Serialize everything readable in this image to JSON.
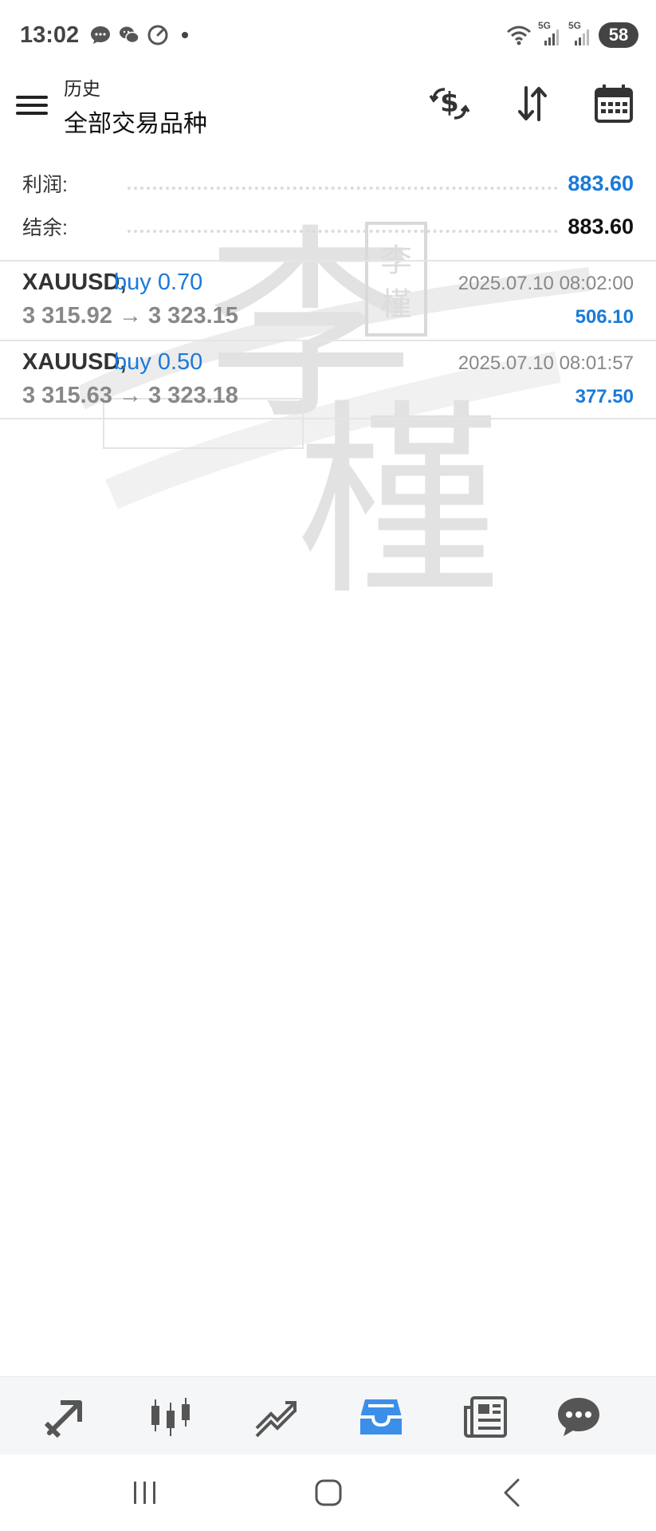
{
  "status_bar": {
    "time": "13:02",
    "signal_label_1": "5G",
    "signal_label_2": "5G",
    "battery": "58",
    "icons": [
      "message-icon",
      "wechat-icon",
      "speed-icon",
      "dot-icon",
      "wifi-icon",
      "signal-icon",
      "signal-icon",
      "battery-icon"
    ]
  },
  "app_bar": {
    "title_small": "历史",
    "title_main": "全部交易品种",
    "actions": [
      "dollar-swap-icon",
      "sort-icon",
      "calendar-icon"
    ]
  },
  "summary": {
    "profit_label": "利润:",
    "profit_value": "883.60",
    "balance_label": "结余:",
    "balance_value": "883.60",
    "profit_color": "#1a7ad9",
    "balance_color": "#111111"
  },
  "deals": [
    {
      "symbol": "XAUUSD,",
      "type": "buy 0.70",
      "prices": "3 315.92 → 3 323.15",
      "time": "2025.07.10 08:02:00",
      "profit": "506.10"
    },
    {
      "symbol": "XAUUSD,",
      "type": "buy 0.50",
      "prices": "3 315.63 → 3 323.18",
      "time": "2025.07.10 08:01:57",
      "profit": "377.50"
    }
  ],
  "watermark": {
    "chars": [
      "李",
      "槿"
    ],
    "seal_chars": [
      "李",
      "槿"
    ]
  },
  "bottom_nav": {
    "items": [
      "quotes-icon",
      "chart-icon",
      "trade-icon",
      "history-icon",
      "news-icon",
      "chat-icon"
    ],
    "active": "history-icon",
    "active_color": "#3b8fe8"
  },
  "system_nav": [
    "recents-icon",
    "home-icon",
    "back-icon"
  ]
}
